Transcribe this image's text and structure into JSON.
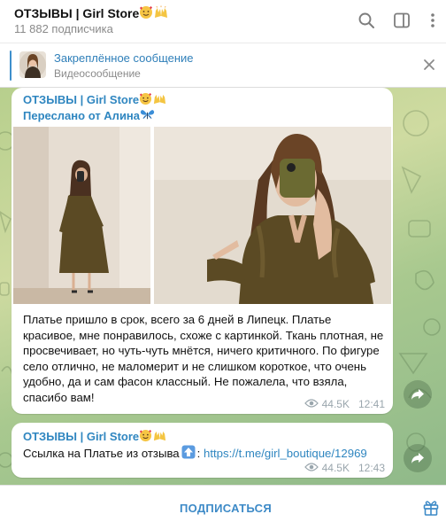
{
  "header": {
    "title": "ОТЗЫВЫ | Girl Store",
    "subscribers": "11 882 подписчика",
    "icons": [
      "search-icon",
      "sidebar-toggle-icon",
      "more-vertical-icon"
    ]
  },
  "pinned": {
    "title": "Закреплённое сообщение",
    "subtitle": "Видеосообщение"
  },
  "messages": [
    {
      "sender": "ОТЗЫВЫ | Girl Store",
      "forwarded_from": "Переслано от Алина",
      "text": "Платье пришло в срок, всего за 6 дней в Липецк. Платье красивое, мне понравилось, схоже с картинкой. Ткань плотная, не просвечивает, но чуть-чуть мнётся, ничего критичного. По фигуре село отлично, не маломерит и не слишком короткое, что очень удобно, да и сам фасон классный. Не пожалела, что взяла, спасибо вам!",
      "views": "44.5K",
      "time": "12:41"
    },
    {
      "sender": "ОТЗЫВЫ | Girl Store",
      "text_prefix": "Ссылка на Платье из отзыва",
      "text_sep": ":",
      "link": "https://t.me/girl_boutique/12969",
      "views": "44.5K",
      "time": "12:43"
    }
  ],
  "footer": {
    "subscribe_label": "ПОДПИСАТЬСЯ"
  },
  "colors": {
    "accent": "#3d8ac7",
    "sender": "#2f86c0",
    "dress": "#5b4a24"
  }
}
